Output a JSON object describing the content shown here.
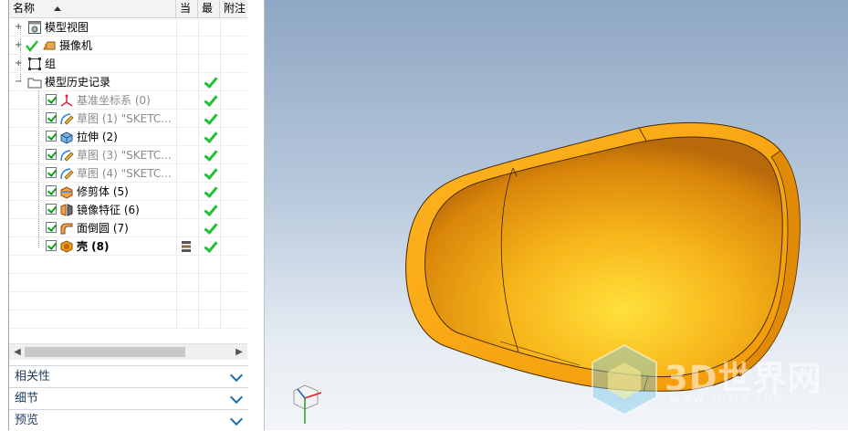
{
  "navigator": {
    "columns": {
      "name": "名称",
      "current": "当",
      "latest": "最",
      "note": "附注"
    },
    "rows": [
      {
        "label": "模型视图",
        "style": "normal",
        "icon": "model-view-icon"
      },
      {
        "label": "摄像机",
        "style": "normal",
        "icon": "camera-icon"
      },
      {
        "label": "组",
        "style": "normal",
        "icon": "group-icon"
      },
      {
        "label": "模型历史记录",
        "style": "normal",
        "icon": "folder-icon"
      },
      {
        "label": "基准坐标系 (0)",
        "style": "gray",
        "icon": "datum-csys-icon"
      },
      {
        "label": "草图 (1) \"SKETC...",
        "style": "gray",
        "icon": "sketch-icon"
      },
      {
        "label": "拉伸 (2)",
        "style": "normal",
        "icon": "extrude-icon"
      },
      {
        "label": "草图 (3) \"SKETC...",
        "style": "gray",
        "icon": "sketch-icon"
      },
      {
        "label": "草图 (4) \"SKETC...",
        "style": "gray",
        "icon": "sketch-icon"
      },
      {
        "label": "修剪体 (5)",
        "style": "normal",
        "icon": "trim-body-icon"
      },
      {
        "label": "镜像特征 (6)",
        "style": "normal",
        "icon": "mirror-feature-icon"
      },
      {
        "label": "面倒圆 (7)",
        "style": "normal",
        "icon": "face-blend-icon"
      },
      {
        "label": "壳 (8)",
        "style": "bold",
        "icon": "shell-icon"
      }
    ],
    "panels": [
      "相关性",
      "细节",
      "预览"
    ]
  },
  "viewport": {
    "watermark": "3D世界网",
    "watermark_url": "WWW.3DSJW.COM"
  },
  "colors": {
    "model_orange": "#f5a30f",
    "check_green": "#22c033",
    "viewport_top": "#8fa7c3",
    "viewport_bottom": "#f3f5f8"
  }
}
